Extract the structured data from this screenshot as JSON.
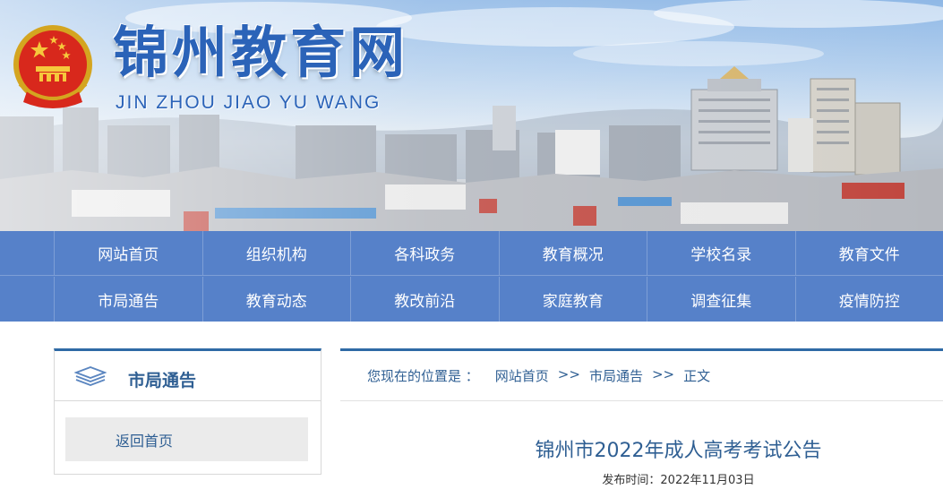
{
  "site": {
    "title": "锦州教育网",
    "pinyin": "JIN ZHOU JIAO YU WANG"
  },
  "nav": {
    "row1": [
      "网站首页",
      "组织机构",
      "各科政务",
      "教育概况",
      "学校名录",
      "教育文件"
    ],
    "row2": [
      "市局通告",
      "教育动态",
      "教改前沿",
      "家庭教育",
      "调查征集",
      "疫情防控"
    ]
  },
  "sidebar": {
    "title": "市局通告",
    "back_label": "返回首页"
  },
  "breadcrumb": {
    "prefix": "您现在的位置是 ：",
    "home": "网站首页",
    "sep1": ">>",
    "section": "市局通告",
    "sep2": ">>",
    "current": "正文"
  },
  "article": {
    "title": "锦州市2022年成人高考考试公告",
    "date_line": "发布时间：2022年11月03日"
  },
  "colors": {
    "nav_bg": "#5681c9",
    "accent": "#2f6aa5",
    "title_blue": "#2b63b8"
  },
  "icons": {
    "emblem": "national-emblem",
    "sidebar": "layers-icon"
  }
}
